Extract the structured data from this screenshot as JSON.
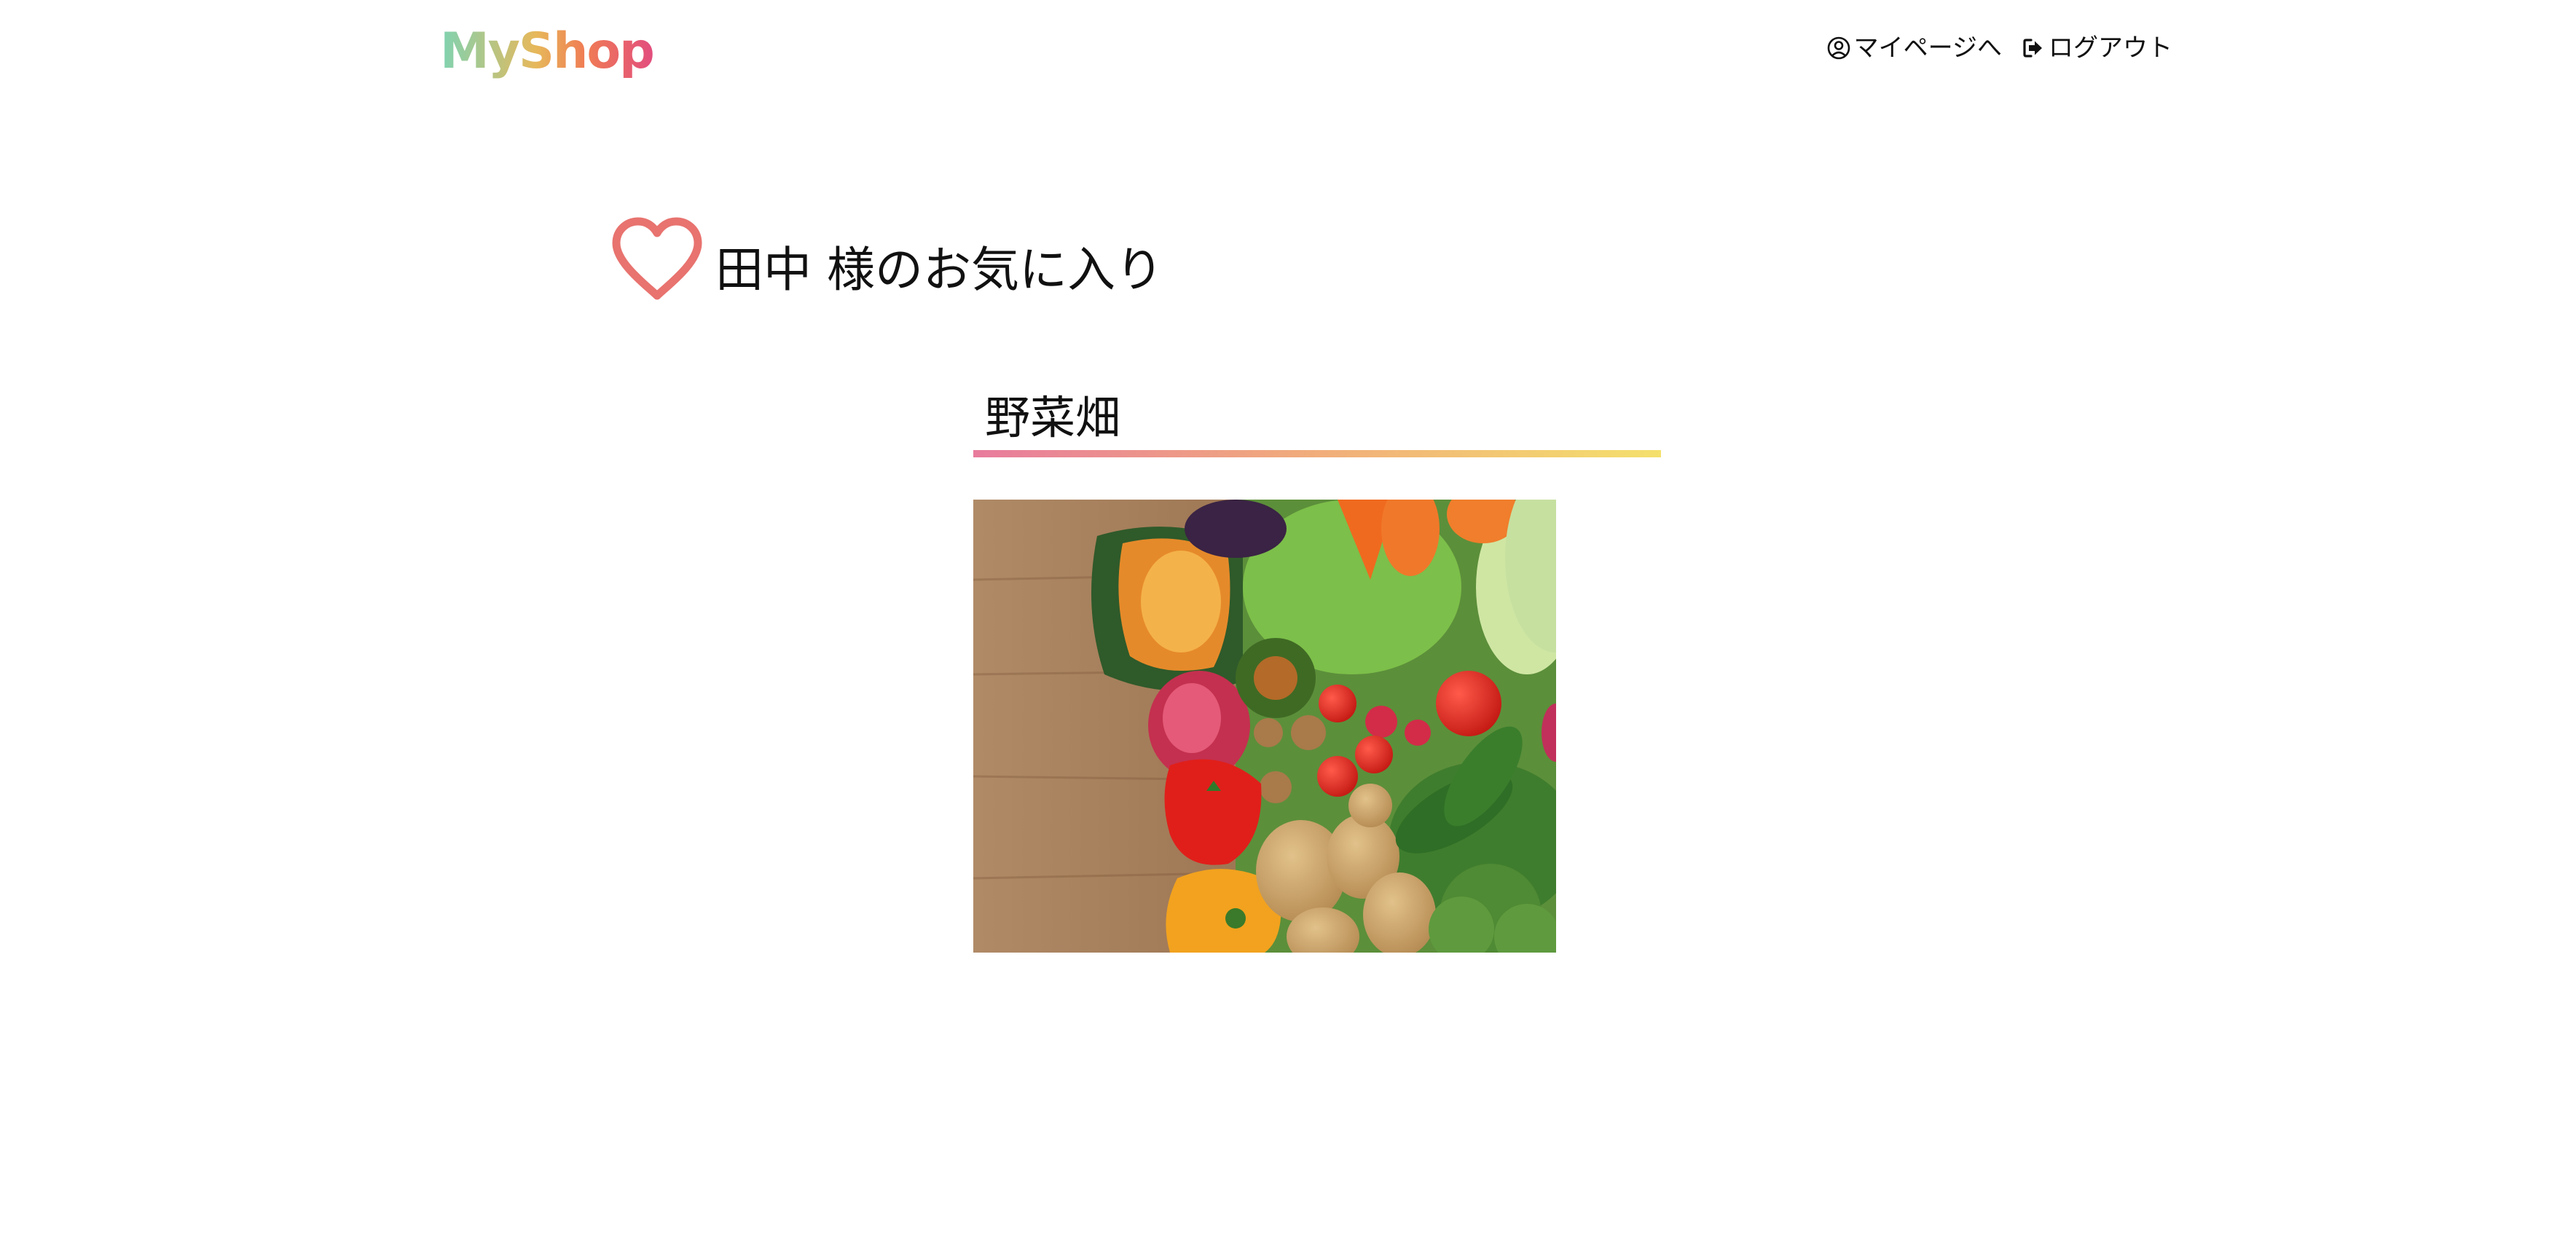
{
  "header": {
    "logo": "MyShop",
    "nav": {
      "mypage_label": "マイページへ",
      "logout_label": "ログアウト"
    }
  },
  "main": {
    "title": "田中 様のお気に入り",
    "favorites": [
      {
        "name": "野菜畑",
        "image_alt": "野菜畑"
      }
    ]
  },
  "colors": {
    "heart": "#e8736f",
    "underline_start": "#e87b9d",
    "underline_mid": "#f1ad7a",
    "underline_end": "#f4e06c",
    "logo_gradient": [
      "#7ed3b2",
      "#e7b85a",
      "#f07c54",
      "#e24d7e"
    ]
  },
  "icons": {
    "mypage": "user-circle-icon",
    "logout": "sign-out-icon",
    "title": "heart-outline-icon"
  }
}
